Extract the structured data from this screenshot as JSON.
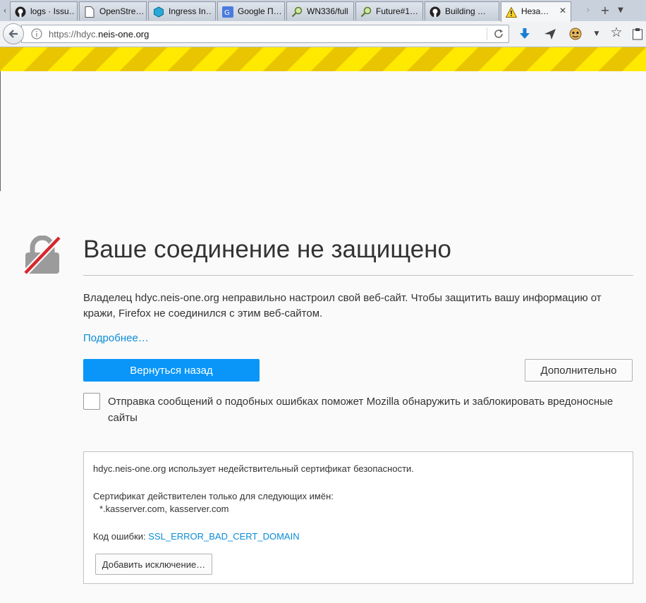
{
  "tabs": [
    {
      "label": "logs · Issu…",
      "icon": "github-icon",
      "active": false
    },
    {
      "label": "OpenStre…",
      "icon": "page-icon",
      "active": false
    },
    {
      "label": "Ingress In…",
      "icon": "ingress-icon",
      "active": false
    },
    {
      "label": "Google П…",
      "icon": "google-translate-icon",
      "active": false
    },
    {
      "label": "WN336/full",
      "icon": "magnifier-icon",
      "active": false
    },
    {
      "label": "Future#1…",
      "icon": "magnifier-icon",
      "active": false
    },
    {
      "label": "Building …",
      "icon": "github-icon",
      "active": false
    },
    {
      "label": "Неза…",
      "icon": "warning-icon",
      "active": true
    }
  ],
  "navbar": {
    "url_prefix": "https://hdyc.",
    "url_domain": "neis-one.org"
  },
  "content": {
    "title": "Ваше соединение не защищено",
    "description": "Владелец hdyc.neis-one.org неправильно настроил свой веб-сайт. Чтобы защитить вашу информацию от кражи, Firefox не соединился с этим веб-сайтом.",
    "learn_more": "Подробнее…",
    "go_back": "Вернуться назад",
    "advanced": "Дополнительно",
    "report_label": "Отправка сообщений о подобных ошибках поможет Mozilla обнаружить и заблокировать вредоносные сайты"
  },
  "advanced_panel": {
    "line1": "hdyc.neis-one.org использует недействительный сертификат безопасности.",
    "line2": "Сертификат действителен только для следующих имён:",
    "line3": "*.kasserver.com, kasserver.com",
    "error_label": "Код ошибки: ",
    "error_code": "SSL_ERROR_BAD_CERT_DOMAIN",
    "add_exception": "Добавить исключение…"
  },
  "colors": {
    "primary_button": "#0996f8",
    "link": "#0a8dd6",
    "stripe_yellow": "#ffe900"
  }
}
